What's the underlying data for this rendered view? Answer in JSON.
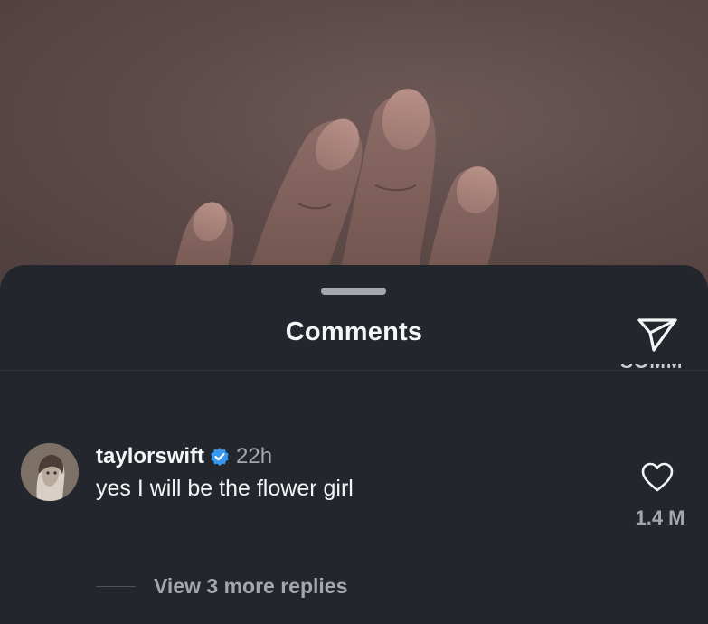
{
  "sheet": {
    "title": "Comments",
    "clipped_label": "SOMM"
  },
  "icons": {
    "share": "paper-plane-icon",
    "verified": "verified-badge-icon",
    "like": "heart-outline-icon",
    "handle": "drag-handle-icon"
  },
  "comment": {
    "username": "taylorswift",
    "timestamp": "22h",
    "text": "yes I will be the flower girl",
    "likes": "1.4 M"
  },
  "replies": {
    "label": "View 3 more replies"
  },
  "colors": {
    "sheet_bg": "#23262c",
    "primary_text": "#f4f5f6",
    "secondary_text": "#a3a8ae",
    "verified_blue": "#3897f0"
  }
}
